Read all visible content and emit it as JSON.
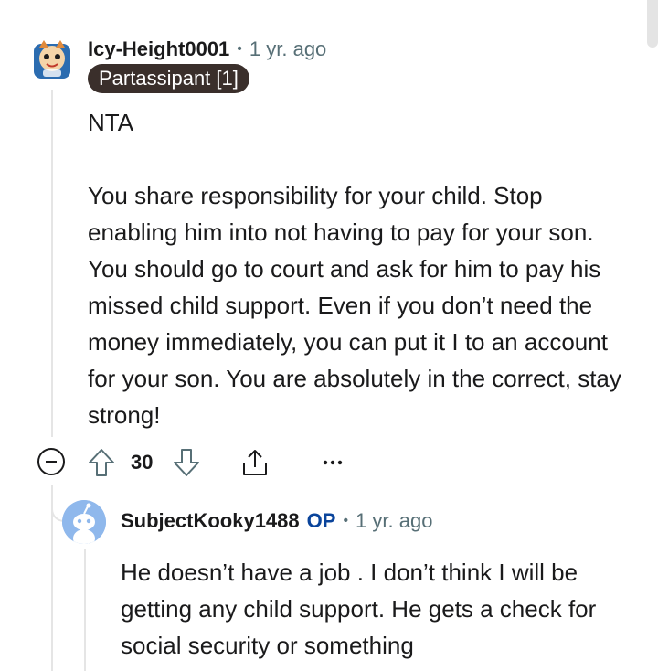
{
  "comment1": {
    "username": "Icy-Height0001",
    "separator": "•",
    "time": "1 yr. ago",
    "flair": "Partassipant [1]",
    "body": "NTA\n\nYou share responsibility for your child. Stop enabling him into not having to pay for your son. You should go to court and ask for him to pay his missed child support. Even if you don’t need the money immediately, you can put it I to an account for your son. You are absolutely in the correct, stay strong!",
    "votes": "30",
    "icons": {
      "collapse": "minus-circle-icon",
      "upvote": "arrow-up-icon",
      "downvote": "arrow-down-icon",
      "share": "share-icon",
      "more": "more-dots-icon"
    }
  },
  "comment2": {
    "username": "SubjectKooky1488",
    "op_badge": "OP",
    "separator": "•",
    "time": "1 yr. ago",
    "body": "He doesn’t have a job . I don’t think I will be getting any child support. He gets a check for social security or something"
  },
  "colors": {
    "text": "#1a1a1b",
    "meta": "#576f76",
    "flair_bg": "#3a2f2b",
    "op": "#0a449b",
    "thread_line": "#e5e5e5",
    "avatar_bg": "#8fb8ec"
  }
}
